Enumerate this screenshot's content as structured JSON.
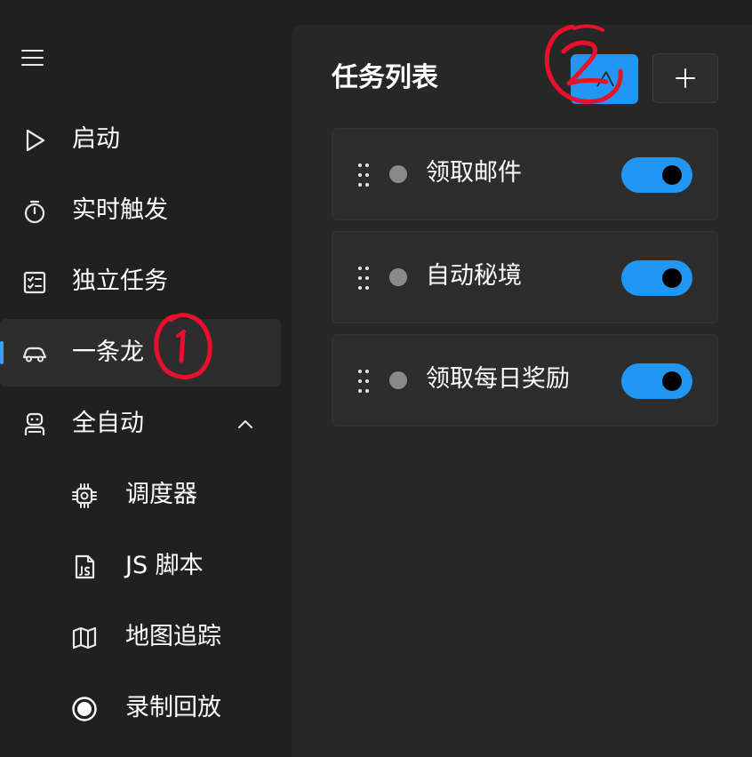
{
  "sidebar": {
    "items": [
      {
        "label": "启动",
        "icon": "play-icon",
        "active": false
      },
      {
        "label": "实时触发",
        "icon": "stopwatch-icon",
        "active": false
      },
      {
        "label": "独立任务",
        "icon": "checklist-icon",
        "active": false
      },
      {
        "label": "一条龙",
        "icon": "car-icon",
        "active": true
      },
      {
        "label": "全自动",
        "icon": "robot-icon",
        "active": false,
        "expanded": true
      }
    ],
    "sub_items": [
      {
        "label": "调度器",
        "icon": "chip-icon"
      },
      {
        "label": "JS 脚本",
        "icon": "js-file-icon"
      },
      {
        "label": "地图追踪",
        "icon": "map-icon"
      },
      {
        "label": "录制回放",
        "icon": "record-icon"
      }
    ]
  },
  "main": {
    "title": "任务列表",
    "tasks": [
      {
        "name": "领取邮件",
        "enabled": true
      },
      {
        "name": "自动秘境",
        "enabled": true
      },
      {
        "name": "领取每日奖励",
        "enabled": true
      }
    ]
  },
  "annotations": {
    "marker_1": "1",
    "marker_2": "2"
  },
  "colors": {
    "accent": "#2196f3",
    "sidebar_bg": "#202020",
    "main_bg": "#272727",
    "card_bg": "#2d2d2d",
    "annotation": "#e8102a"
  }
}
